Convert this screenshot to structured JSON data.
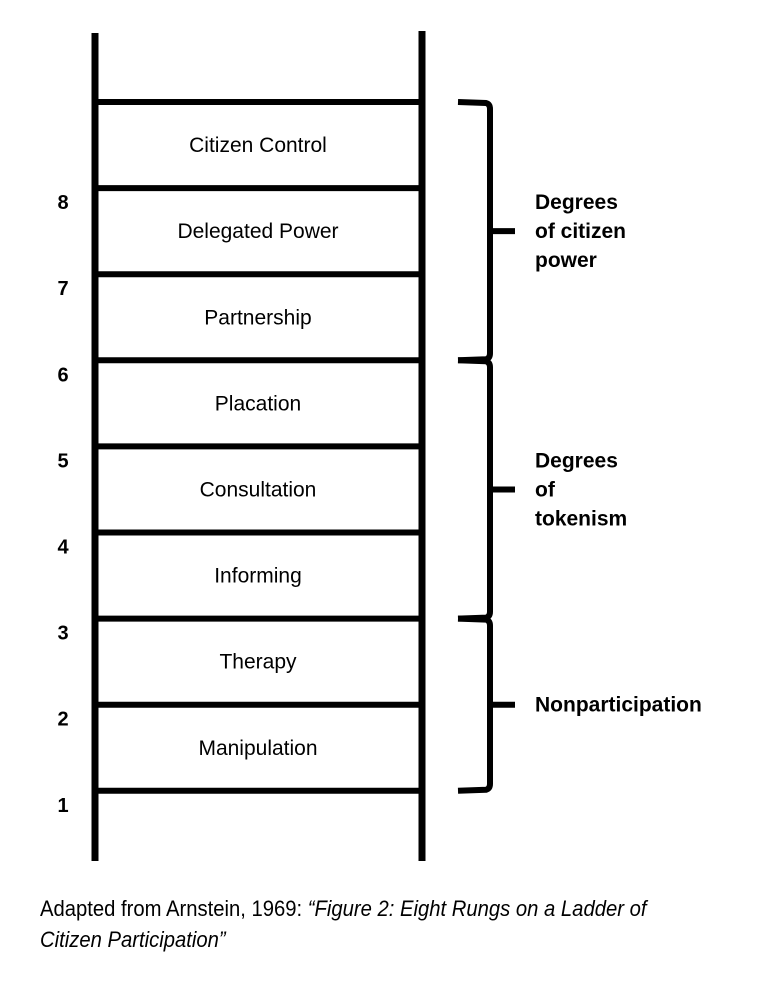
{
  "diagram": {
    "title": "Ladder of Citizen Participation",
    "rungs": [
      {
        "number": "8",
        "label": "Citizen Control"
      },
      {
        "number": "7",
        "label": "Delegated Power"
      },
      {
        "number": "6",
        "label": "Partnership"
      },
      {
        "number": "5",
        "label": "Placation"
      },
      {
        "number": "4",
        "label": "Consultation"
      },
      {
        "number": "3",
        "label": "Informing"
      },
      {
        "number": "2",
        "label": "Therapy"
      },
      {
        "number": "1",
        "label": "Manipulation"
      }
    ],
    "groups": [
      {
        "name": "degrees-of-citizen-power",
        "lines": [
          "Degrees",
          "of citizen",
          "power"
        ],
        "from_rung": 6,
        "to_rung": 8
      },
      {
        "name": "degrees-of-tokenism",
        "lines": [
          "Degrees",
          "of",
          "tokenism"
        ],
        "from_rung": 3,
        "to_rung": 5
      },
      {
        "name": "nonparticipation",
        "lines": [
          "Nonparticipation"
        ],
        "from_rung": 1,
        "to_rung": 2
      }
    ]
  },
  "caption": {
    "prefix": "Adapted from Arnstein, 1969: ",
    "quote": "“Figure 2: Eight Rungs on a Ladder of Citizen Participation”"
  }
}
